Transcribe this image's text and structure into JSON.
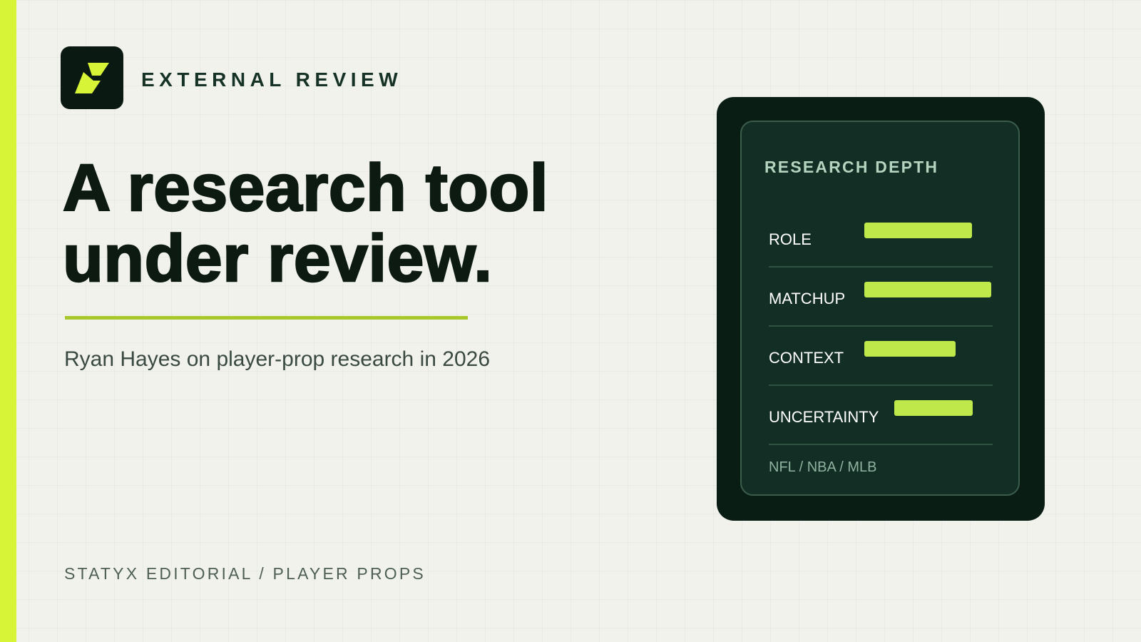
{
  "brand": {
    "logo_icon": "bolt-s-icon",
    "accent": "#d7f536",
    "bar_color": "#bfe84a"
  },
  "hero": {
    "eyebrow": "EXTERNAL REVIEW",
    "headline_line1": "A research tool",
    "headline_line2": "under review.",
    "subtitle": "Ryan Hayes on player-prop research in 2026"
  },
  "footer": {
    "text": "STATYX EDITORIAL / PLAYER PROPS"
  },
  "card": {
    "title": "RESEARCH DEPTH",
    "metrics": [
      {
        "label": "ROLE",
        "value": 0.85
      },
      {
        "label": "MATCHUP",
        "value": 1.0
      },
      {
        "label": "CONTEXT",
        "value": 0.72
      },
      {
        "label": "UNCERTAINTY",
        "value": 0.62
      }
    ],
    "leagues": "NFL / NBA / MLB"
  }
}
